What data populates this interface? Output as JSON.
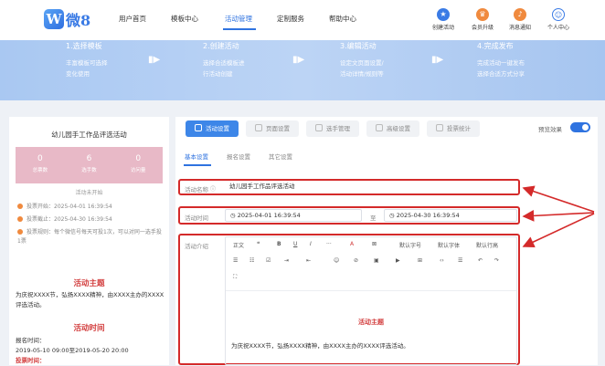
{
  "header": {
    "logo_text": "微8",
    "nav": [
      "用户首页",
      "模板中心",
      "活动管理",
      "定制服务",
      "帮助中心"
    ],
    "utils": [
      "创建活动",
      "会员升级",
      "消息通知",
      "个人中心"
    ]
  },
  "steps": [
    {
      "title": "1.选择模板",
      "desc": [
        "丰富模板可选择",
        "变化使用"
      ]
    },
    {
      "title": "2.创建活动",
      "desc": [
        "选择合适模板进",
        "行活动创建"
      ]
    },
    {
      "title": "3.编辑活动",
      "desc": [
        "设定文页面设置/",
        "活动详情/规则等"
      ]
    },
    {
      "title": "4.完成发布",
      "desc": [
        "完成活动一键发布",
        "选择合适方式分享"
      ]
    }
  ],
  "left": {
    "title": "幼儿园手工作品评选活动",
    "stats": [
      {
        "n": "0",
        "l": "总票数"
      },
      {
        "n": "6",
        "l": "选手数"
      },
      {
        "n": "0",
        "l": "访问量"
      }
    ],
    "status": "活动未开始",
    "info": [
      "投票开始：2025-04-01 16:39:54",
      "投票截止：2025-04-30 16:39:54",
      "投票规则：每个微信号每天可投1次，可以对同一选手投1票"
    ],
    "article": {
      "h1": "活动主题",
      "p1": "为庆祝XXXX节，弘扬XXXX精神，由XXXX主办的XXXX评选活动。",
      "h2": "活动时间",
      "time_label": "报名时间：",
      "time_value": "2019-05-10 09:00至2019-05-20 20:00",
      "vote_label": "投票时间："
    }
  },
  "tabs": [
    "活动设置",
    "页面设置",
    "选手管理",
    "高级设置",
    "投票统计"
  ],
  "preview_label": "预览效果",
  "subtabs": [
    "基本设置",
    "报名设置",
    "其它设置"
  ],
  "form": {
    "name_label": "活动名称",
    "name_value": "幼儿园手工作品评选活动",
    "time_label": "活动时间",
    "start": "2025-04-01 16:39:54",
    "sep": "至",
    "end": "2025-04-30 16:39:54",
    "intro_label": "活动介绍"
  },
  "toolbar": {
    "row1": [
      "正文",
      "❝",
      "B",
      "U",
      "I",
      "···",
      "A",
      "⊠",
      "默认字号",
      "默认字体",
      "默认行高"
    ],
    "row2": [
      "☰",
      "☷",
      "☑",
      "⇥",
      "⇤",
      "☺",
      "⊘",
      "▣",
      "▶",
      "⊞",
      "‹›",
      "☰",
      "↶",
      "↷"
    ],
    "row3": [
      "⛶"
    ]
  },
  "editor": {
    "heading": "活动主题",
    "text": "为庆祝XXXX节，弘扬XXXX精神，由XXXX主办的XXXX评选活动。"
  }
}
